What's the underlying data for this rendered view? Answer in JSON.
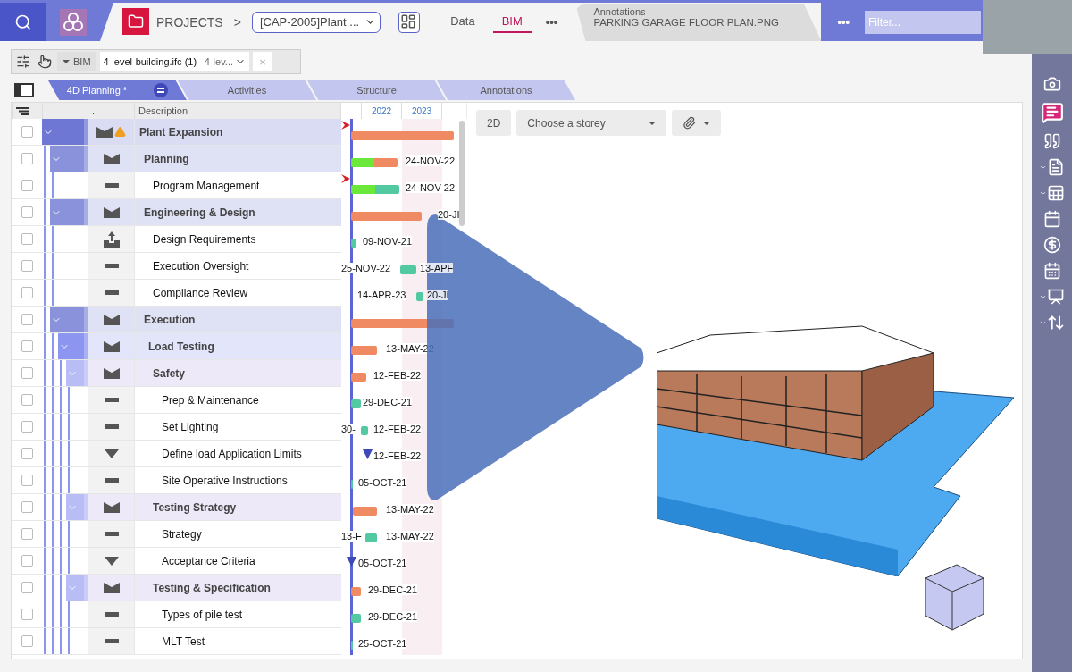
{
  "top_bar": {
    "breadcrumb": "PROJECTS",
    "separator": ">",
    "project": "[CAP-2005]Plant ...",
    "tabs": [
      {
        "label": "Data",
        "selected": false
      },
      {
        "label": "BIM",
        "selected": true
      }
    ],
    "more": "•••",
    "document_tab": {
      "type": "Annotations",
      "name": "PARKING GARAGE FLOOR PLAN.PNG"
    },
    "more_right": "•••",
    "filter": {
      "placeholder": "Filter..."
    }
  },
  "toolbar": {
    "mode": "BIM",
    "file": "4-level-building.ifc (1)",
    "file_suffix": " - 4-lev...",
    "clear": "×"
  },
  "view_tabs": [
    {
      "label": "4D Planning *",
      "selected": true
    },
    {
      "label": "Activities",
      "selected": false
    },
    {
      "label": "Structure",
      "selected": false
    },
    {
      "label": "Annotations",
      "selected": false
    }
  ],
  "grid": {
    "columns": [
      ".",
      "Description"
    ],
    "years": [
      "2022",
      "2023"
    ],
    "rows": [
      {
        "label": "Plant Expansion",
        "kind": "summary",
        "warning": true,
        "expanded": true,
        "checked": false,
        "children": [
          {
            "label": "Planning",
            "kind": "summary",
            "expanded": true,
            "checked": false,
            "children": [
              {
                "label": "Program Management",
                "kind": "task",
                "checked": false
              }
            ]
          },
          {
            "label": "Engineering & Design",
            "kind": "summary",
            "expanded": true,
            "checked": false,
            "children": [
              {
                "label": "Design Requirements",
                "kind": "deliverable",
                "checked": false
              },
              {
                "label": "Execution Oversight",
                "kind": "task",
                "checked": false
              },
              {
                "label": "Compliance Review",
                "kind": "task",
                "checked": false
              }
            ]
          },
          {
            "label": "Execution",
            "kind": "summary",
            "expanded": true,
            "checked": false,
            "children": [
              {
                "label": "Load Testing",
                "kind": "summary",
                "expanded": true,
                "checked": false,
                "children": [
                  {
                    "label": "Safety",
                    "kind": "summary",
                    "expanded": true,
                    "checked": false,
                    "children": [
                      {
                        "label": "Prep & Maintenance",
                        "kind": "task",
                        "checked": false
                      },
                      {
                        "label": "Set Lighting",
                        "kind": "task",
                        "checked": false
                      },
                      {
                        "label": "Define load Application Limits",
                        "kind": "milestone",
                        "checked": false
                      },
                      {
                        "label": "Site Operative Instructions",
                        "kind": "task",
                        "checked": false
                      }
                    ]
                  },
                  {
                    "label": "Testing Strategy",
                    "kind": "summary",
                    "expanded": true,
                    "checked": false,
                    "children": [
                      {
                        "label": "Strategy",
                        "kind": "task",
                        "checked": false
                      },
                      {
                        "label": "Acceptance Criteria",
                        "kind": "milestone",
                        "checked": false
                      }
                    ]
                  },
                  {
                    "label": "Testing & Specification",
                    "kind": "summary",
                    "expanded": true,
                    "checked": false,
                    "children": [
                      {
                        "label": "Types of pile test",
                        "kind": "task",
                        "checked": false
                      },
                      {
                        "label": "MLT Test",
                        "kind": "task",
                        "checked": false
                      }
                    ]
                  }
                ]
              }
            ]
          }
        ]
      }
    ]
  },
  "gantt": {
    "rows": [
      {
        "kind": "summary",
        "flag": true
      },
      {
        "kind": "progress-summary",
        "level": 0.5,
        "label": "24-NOV-22"
      },
      {
        "kind": "progress-task",
        "level": 0.5,
        "label": "24-NOV-22",
        "flag": true
      },
      {
        "kind": "summary",
        "label": "20-JI"
      },
      {
        "kind": "task",
        "label": "09-NOV-21"
      },
      {
        "kind": "task",
        "before": "25-NOV-22",
        "label": "13-APF"
      },
      {
        "kind": "task",
        "before": "14-APR-23",
        "label": "20-JI"
      },
      {
        "kind": "summary"
      },
      {
        "kind": "summary",
        "label": "13-MAY-22"
      },
      {
        "kind": "summary",
        "label": "12-FEB-22"
      },
      {
        "kind": "task",
        "label": "29-DEC-21"
      },
      {
        "kind": "task",
        "before": "30-",
        "label": "12-FEB-22"
      },
      {
        "kind": "milestone",
        "label": "12-FEB-22"
      },
      {
        "kind": "task",
        "label": "05-OCT-21"
      },
      {
        "kind": "summary",
        "label": "13-MAY-22"
      },
      {
        "kind": "task",
        "before": "13-F",
        "label": "13-MAY-22"
      },
      {
        "kind": "milestone",
        "label": "05-OCT-21"
      },
      {
        "kind": "summary",
        "label": "29-DEC-21"
      },
      {
        "kind": "task",
        "label": "29-DEC-21"
      },
      {
        "kind": "task",
        "label": "25-OCT-21"
      }
    ]
  },
  "viewer": {
    "mode_button": "2D",
    "storey": {
      "placeholder": "Choose a storey"
    }
  }
}
